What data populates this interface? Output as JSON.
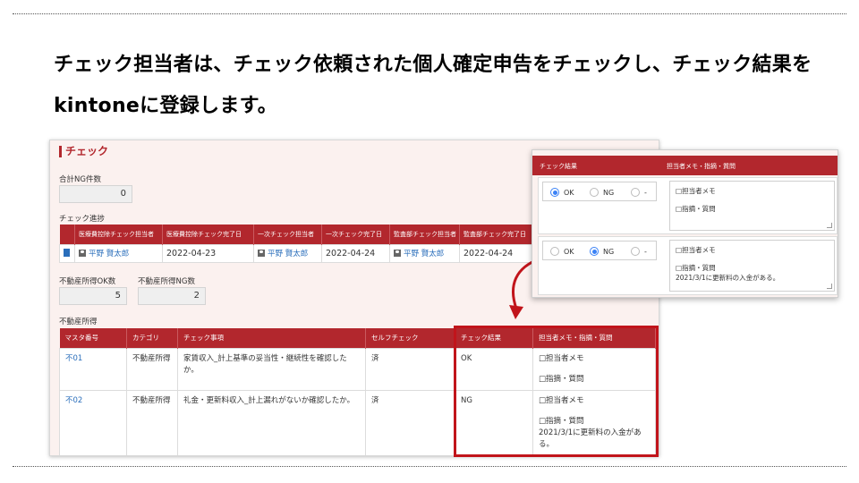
{
  "slide": {
    "heading": "チェック担当者は、チェック依頼された個人確定申告をチェックし、チェック結果をkintoneに登録します。"
  },
  "check_section": {
    "title": "チェック",
    "total_ng_label": "合計NG件数",
    "total_ng_value": "0",
    "progress_label": "チェック進捗",
    "progress_headers": [
      "",
      "医療費控除チェック担当者",
      "医療費控除チェック完了日",
      "一次チェック担当者",
      "一次チェック完了日",
      "監査部チェック担当者",
      "監査部チェック完了日"
    ],
    "progress_row": {
      "medical_checker": "平野 賢太郎",
      "medical_date": "2022-04-23",
      "primary_checker": "平野 賢太郎",
      "primary_date": "2022-04-24",
      "audit_checker": "平野 賢太郎",
      "audit_date": "2022-04-24"
    },
    "re_ok_label": "不動産所得OK数",
    "re_ok_value": "5",
    "re_ng_label": "不動産所得NG数",
    "re_ng_value": "2",
    "re_table_label": "不動産所得",
    "re_headers": [
      "マスタ番号",
      "カテゴリ",
      "チェック事項",
      "セルフチェック",
      "チェック結果",
      "担当者メモ・指摘・質問"
    ],
    "re_rows": [
      {
        "id": "不01",
        "category": "不動産所得",
        "item": "家賃収入_計上基準の妥当性・継続性を確認したか。",
        "self": "済",
        "result": "OK",
        "memo1": "□担当者メモ",
        "memo2": "□指摘・質問",
        "memo3": ""
      },
      {
        "id": "不02",
        "category": "不動産所得",
        "item": "礼金・更新料収入_計上漏れがないか確認したか。",
        "self": "済",
        "result": "NG",
        "memo1": "□担当者メモ",
        "memo2": "□指摘・質問",
        "memo3": "2021/3/1に更新料の入金がある。"
      }
    ]
  },
  "popup": {
    "header_result": "チェック結果",
    "header_memo": "担当者メモ・指摘・質問",
    "options": [
      "OK",
      "NG",
      "-"
    ],
    "rows": [
      {
        "selected": "OK",
        "memo1": "□担当者メモ",
        "memo2": "□指摘・質問",
        "memo3": ""
      },
      {
        "selected": "NG",
        "memo1": "□担当者メモ",
        "memo2": "□指摘・質問",
        "memo3": "2021/3/1に更新料の入金がある。"
      }
    ]
  },
  "colors": {
    "header_red": "#b2272d",
    "highlight_red": "#c1141b",
    "link_blue": "#2a6ebb",
    "radio_blue": "#3b82f6",
    "panel_bg": "#fbf1ef"
  }
}
